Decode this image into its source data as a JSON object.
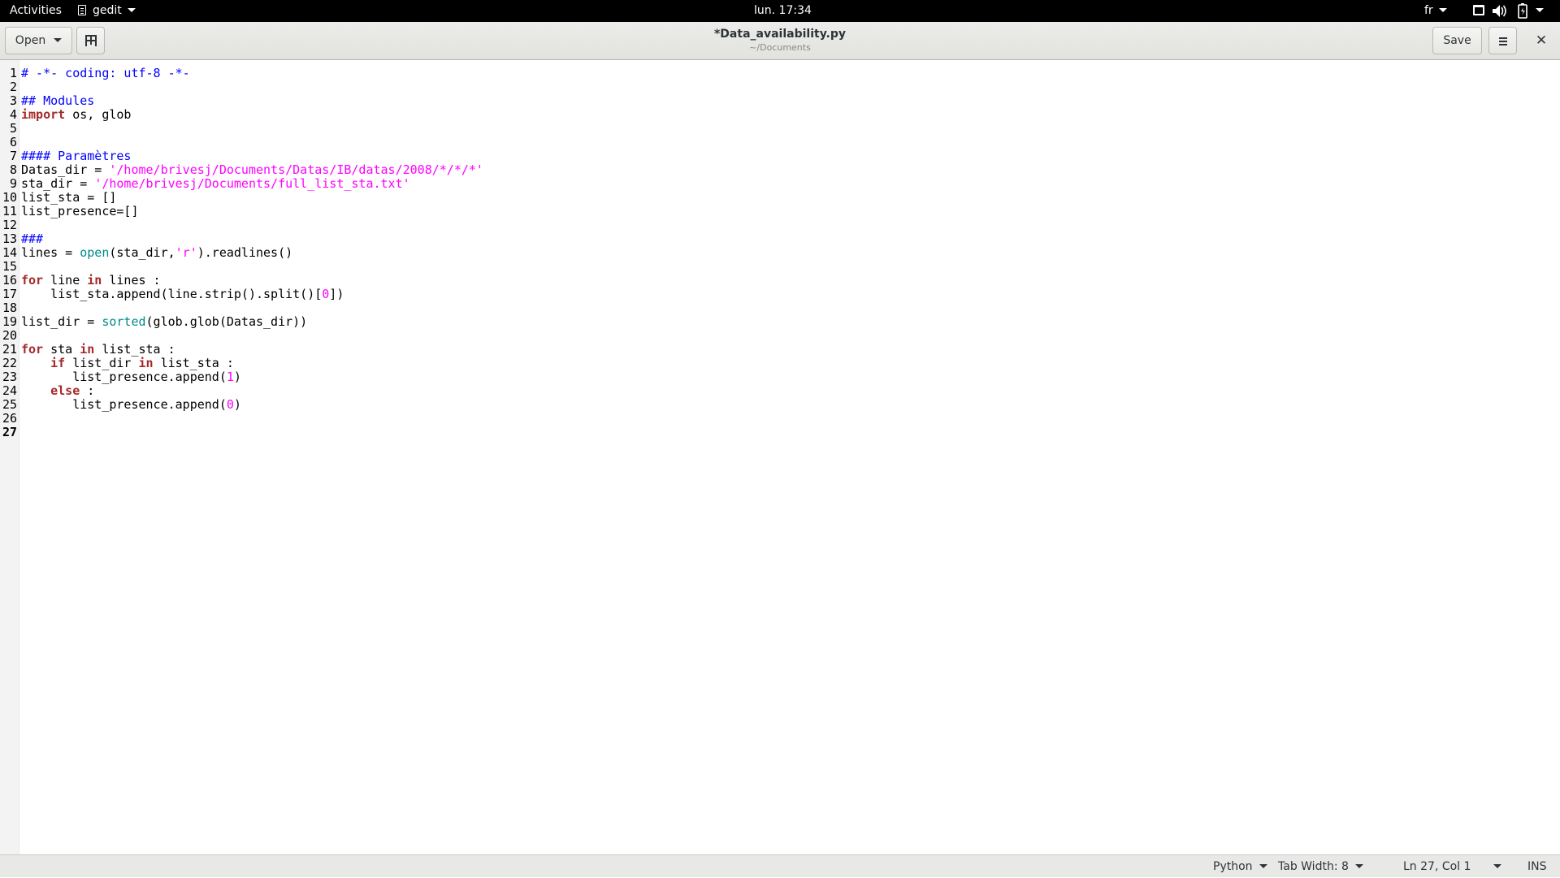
{
  "topbar": {
    "activities": "Activities",
    "app_name": "gedit",
    "clock": "lun. 17:34",
    "language": "fr"
  },
  "headerbar": {
    "open_label": "Open",
    "title": "*Data_availability.py",
    "subtitle": "~/Documents",
    "save_label": "Save"
  },
  "editor": {
    "current_line": 27,
    "lines": [
      [
        {
          "t": "comment",
          "v": "# -*- coding: utf-8 -*-"
        }
      ],
      [],
      [
        {
          "t": "comment",
          "v": "## Modules"
        }
      ],
      [
        {
          "t": "keyword",
          "v": "import"
        },
        {
          "t": "plain",
          "v": " os, glob"
        }
      ],
      [],
      [],
      [
        {
          "t": "comment",
          "v": "#### Paramètres"
        }
      ],
      [
        {
          "t": "plain",
          "v": "Datas_dir = "
        },
        {
          "t": "string",
          "v": "'/home/brivesj/Documents/Datas/IB/datas/2008/*/*/*'"
        }
      ],
      [
        {
          "t": "plain",
          "v": "sta_dir = "
        },
        {
          "t": "string",
          "v": "'/home/brivesj/Documents/full_list_sta.txt'"
        }
      ],
      [
        {
          "t": "plain",
          "v": "list_sta = []"
        }
      ],
      [
        {
          "t": "plain",
          "v": "list_presence=[]"
        }
      ],
      [],
      [
        {
          "t": "comment",
          "v": "###"
        }
      ],
      [
        {
          "t": "plain",
          "v": "lines = "
        },
        {
          "t": "builtin",
          "v": "open"
        },
        {
          "t": "plain",
          "v": "(sta_dir,"
        },
        {
          "t": "string",
          "v": "'r'"
        },
        {
          "t": "plain",
          "v": ").readlines()"
        }
      ],
      [],
      [
        {
          "t": "keyword",
          "v": "for"
        },
        {
          "t": "plain",
          "v": " line "
        },
        {
          "t": "keyword",
          "v": "in"
        },
        {
          "t": "plain",
          "v": " lines :"
        }
      ],
      [
        {
          "t": "plain",
          "v": "    list_sta.append(line.strip().split()["
        },
        {
          "t": "number",
          "v": "0"
        },
        {
          "t": "plain",
          "v": "])"
        }
      ],
      [],
      [
        {
          "t": "plain",
          "v": "list_dir = "
        },
        {
          "t": "builtin",
          "v": "sorted"
        },
        {
          "t": "plain",
          "v": "(glob.glob(Datas_dir))"
        }
      ],
      [],
      [
        {
          "t": "keyword",
          "v": "for"
        },
        {
          "t": "plain",
          "v": " sta "
        },
        {
          "t": "keyword",
          "v": "in"
        },
        {
          "t": "plain",
          "v": " list_sta :"
        }
      ],
      [
        {
          "t": "plain",
          "v": "    "
        },
        {
          "t": "keyword",
          "v": "if"
        },
        {
          "t": "plain",
          "v": " list_dir "
        },
        {
          "t": "keyword",
          "v": "in"
        },
        {
          "t": "plain",
          "v": " list_sta :"
        }
      ],
      [
        {
          "t": "plain",
          "v": "       list_presence.append("
        },
        {
          "t": "number",
          "v": "1"
        },
        {
          "t": "plain",
          "v": ")"
        }
      ],
      [
        {
          "t": "plain",
          "v": "    "
        },
        {
          "t": "keyword",
          "v": "else"
        },
        {
          "t": "plain",
          "v": " :"
        }
      ],
      [
        {
          "t": "plain",
          "v": "       list_presence.append("
        },
        {
          "t": "number",
          "v": "0"
        },
        {
          "t": "plain",
          "v": ")"
        }
      ],
      [],
      []
    ]
  },
  "statusbar": {
    "language": "Python",
    "tab_width": "Tab Width: 8",
    "cursor_position": "Ln 27, Col 1",
    "insert_mode": "INS"
  },
  "colors": {
    "comment": "#0000ff",
    "keyword": "#a52a2a",
    "string": "#ff00ff",
    "builtin": "#008a8c"
  },
  "icons": {
    "app_icon": "document-icon",
    "new_tab": "new-tab-icon",
    "menu": "hamburger-menu-icon",
    "close": "close-icon",
    "window": "window-icon",
    "volume": "volume-icon",
    "battery": "battery-icon"
  }
}
